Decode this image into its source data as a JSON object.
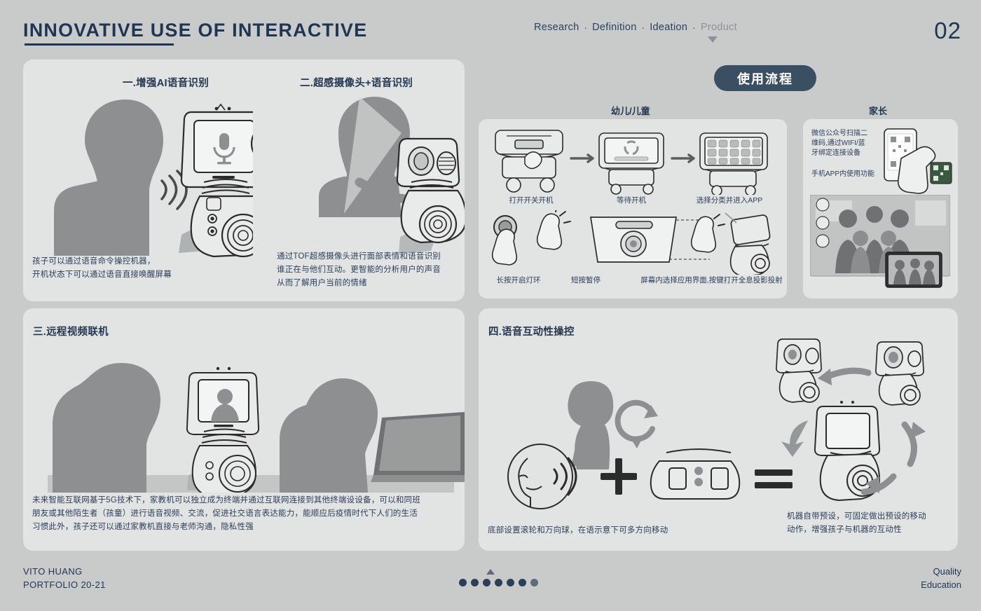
{
  "header": {
    "title": "INNOVATIVE USE OF INTERACTIVE",
    "nav": [
      {
        "label": "Research",
        "active": true
      },
      {
        "label": "Definition",
        "active": true
      },
      {
        "label": "Ideation",
        "active": true
      },
      {
        "label": "Product",
        "active": false
      }
    ],
    "separator": "·",
    "page_number": "02"
  },
  "colors": {
    "background": "#c9cbcb",
    "card": "#e2e3e3",
    "accent_navy": "#1e3553",
    "badge": "#3b4f63",
    "text": "#2b3f58",
    "silhouette": "#8d8f90"
  },
  "cards": {
    "card1": {
      "sections": [
        {
          "title": "一.增强AI语音识别",
          "caption": "孩子可以通过语音命令操控机器，\n开机状态下可以通过语音直接唤醒屏幕"
        },
        {
          "title": "二.超感摄像头+语音识别",
          "caption": "通过TOF超感摄像头进行面部表情和语音识别\n谁正在与他们互动。更智能的分析用户的声音\n从而了解用户当前的情绪"
        }
      ]
    },
    "card3": {
      "title": "三.远程视频联机",
      "caption": "未来智能互联网基于5G技术下，家教机可以独立成为终端并通过互联网连接到其他终端设设备，可以和同班\n朋友或其他陌生者（孩童）进行语音视频、交流，促进社交语言表达能力，能顺应后疫情时代下人们的生活\n习惯此外，孩子还可以通过家教机直接与老师沟通，隐私性强"
    },
    "card4": {
      "title": "四.语音互动性操控",
      "caption_left": "底部设置滚轮和万向球，在语示意下可多方向移动",
      "caption_right": "机器自带预设，可固定做出预设的移动\n动作，增强孩子与机器的互动性"
    }
  },
  "flow": {
    "badge": "使用流程",
    "columns": [
      {
        "label": "幼儿/儿童"
      },
      {
        "label": "家长"
      }
    ],
    "steps_row1": [
      "打开开关开机",
      "等待开机",
      "选择分类并进入APP"
    ],
    "steps_row2": [
      "长按开启灯环",
      "短按暂停",
      "屏幕内选择应用界面,按键打开全息投影投射"
    ],
    "parent_panel": {
      "text1": "微信公众号扫描二维码,通过WIFI/蓝牙绑定连接设备",
      "text2": "手机APP内使用功能"
    }
  },
  "footer": {
    "author": "VITO HUANG",
    "portfolio": "PORTFOLIO 20-21",
    "tag_line1": "Quality",
    "tag_line2": "Education",
    "dots_total": 7,
    "dots_active_index": 6
  },
  "icons": {
    "mic": "microphone-icon",
    "nav_marker": "triangle-down-icon",
    "dots_marker": "triangle-up-icon"
  }
}
